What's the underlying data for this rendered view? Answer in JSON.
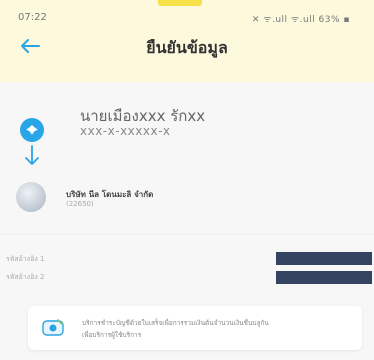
{
  "status_bar": {
    "time": "07:22",
    "icons_text": "✕ ᯤ.ull ᯤ.ull 63% ▪"
  },
  "header": {
    "title": "ยืนยันข้อมูล",
    "back_icon": "arrow-left-icon"
  },
  "from_account": {
    "name": "นายเมืองxxx รักxx",
    "account_number": "xxx-x-xxxxx-x",
    "bank_icon": "bank-logo-icon",
    "icon_color": "#29a6e8"
  },
  "to_account": {
    "name": "บริษัท นีล โดนมะลิ จำกัด",
    "code": "(22650)",
    "avatar_icon": "merchant-avatar"
  },
  "details": [
    {
      "label": "รหัสอ้างอิง 1"
    },
    {
      "label": "รหัสอ้างอิง 2"
    }
  ],
  "info": {
    "line1": "บริการชำระบัญชีด้วยใบเสร็จเพื่อการรวมเงินต้นจำนวนเงินชื่นบลูกัน",
    "line2": "เพื่อบริการผู้ใช้บริการ"
  },
  "colors": {
    "accent": "#29a6e8",
    "header_bg": "#fdf9dc",
    "redaction": "#354561",
    "tab_marker": "#f6e14a"
  }
}
